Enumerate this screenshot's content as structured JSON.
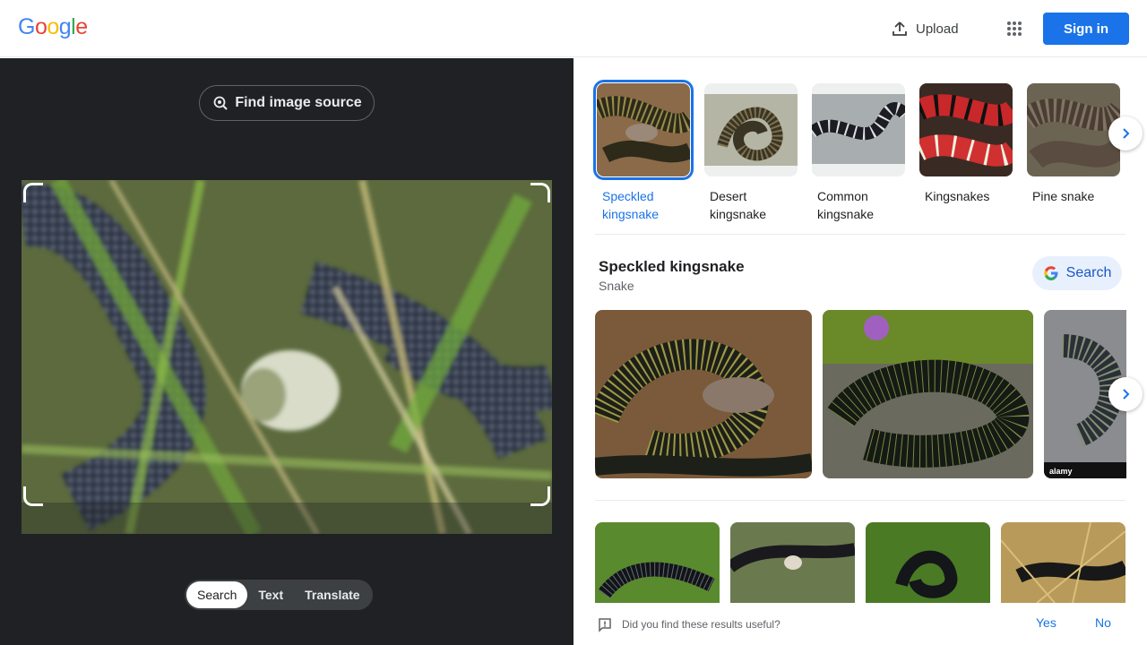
{
  "header": {
    "logo_letters": [
      "G",
      "o",
      "o",
      "g",
      "l",
      "e"
    ],
    "logo_colors": [
      "#4285f4",
      "#ea4335",
      "#fbbc05",
      "#4285f4",
      "#34a853",
      "#ea4335"
    ],
    "upload_label": "Upload",
    "signin_label": "Sign in",
    "accent": "#1a73e8"
  },
  "left": {
    "find_source_label": "Find image source",
    "modes": [
      {
        "label": "Search",
        "active": true
      },
      {
        "label": "Text",
        "active": false
      },
      {
        "label": "Translate",
        "active": false
      }
    ]
  },
  "related": {
    "items": [
      {
        "label": "Speckled kingsnake",
        "selected": true
      },
      {
        "label": "Desert kingsnake",
        "selected": false
      },
      {
        "label": "Common kingsnake",
        "selected": false
      },
      {
        "label": "Kingsnakes",
        "selected": false
      },
      {
        "label": "Pine snake",
        "selected": false
      }
    ]
  },
  "knowledge": {
    "title": "Speckled kingsnake",
    "subtitle": "Snake",
    "search_label": "Search"
  },
  "feedback": {
    "question": "Did you find these results useful?",
    "yes": "Yes",
    "no": "No"
  }
}
